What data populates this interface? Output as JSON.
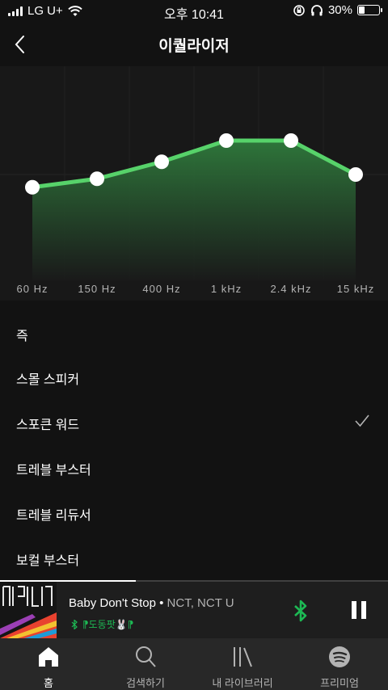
{
  "status_bar": {
    "carrier": "LG U+",
    "time": "오후 10:41",
    "battery": "30%",
    "battery_level": 0.3
  },
  "header": {
    "title": "이퀄라이저",
    "back_icon": "chevron-left-icon"
  },
  "equalizer": {
    "bands": [
      "60 Hz",
      "150 Hz",
      "400 Hz",
      "1 kHz",
      "2.4 kHz",
      "15 kHz"
    ],
    "gains": [
      -1.5,
      -0.5,
      1.5,
      4.0,
      4.0,
      0.0
    ],
    "gain_range": [
      -12,
      12
    ],
    "accent_color": "#57d26a"
  },
  "presets": {
    "items": [
      {
        "label": "즉"
      },
      {
        "label": "스몰 스피커"
      },
      {
        "label": "스포큰 워드",
        "selected": true
      },
      {
        "label": "트레블 부스터"
      },
      {
        "label": "트레블 리듀서"
      },
      {
        "label": "보컬 부스터"
      }
    ],
    "check_icon": "checkmark-icon"
  },
  "now_playing": {
    "title": "Baby Don't Stop",
    "separator": " • ",
    "artist": "NCT, NCT U",
    "device": "⁋도동팟🐰⁋",
    "progress": 0.35,
    "accent_color": "#1db954"
  },
  "tabs": [
    {
      "label": "홈",
      "icon": "home-icon",
      "active": true
    },
    {
      "label": "검색하기",
      "icon": "search-icon"
    },
    {
      "label": "내 라이브러리",
      "icon": "library-icon"
    },
    {
      "label": "프리미엄",
      "icon": "spotify-logo-icon"
    }
  ]
}
